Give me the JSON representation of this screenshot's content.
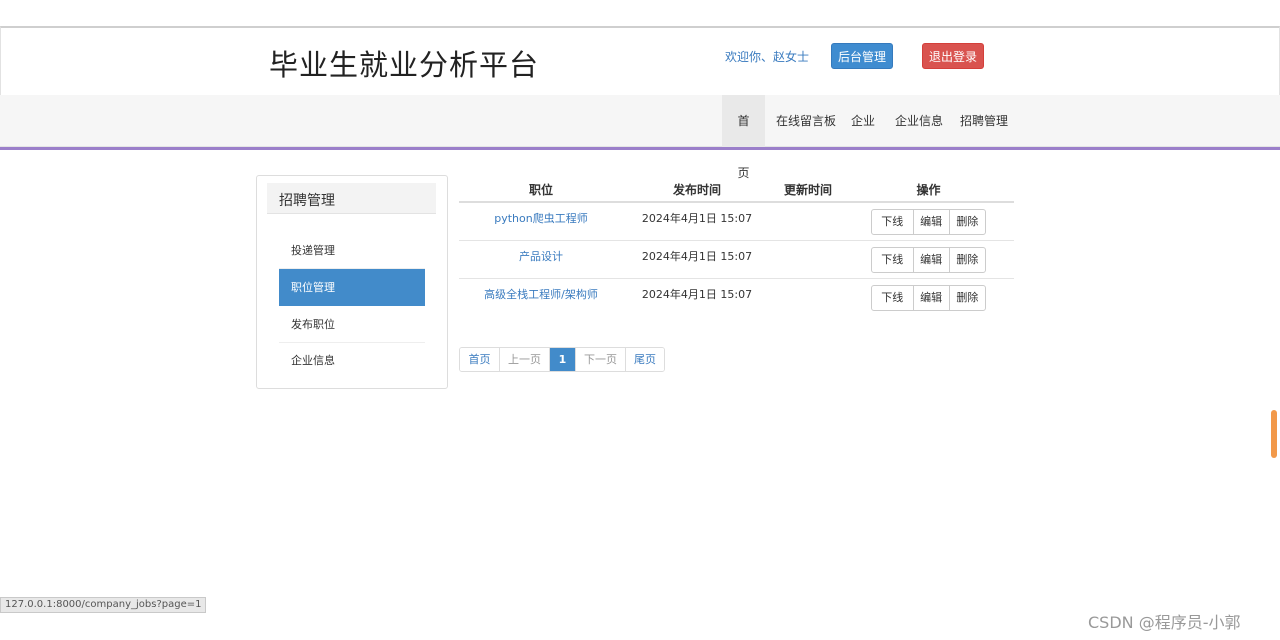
{
  "header": {
    "site_title": "毕业生就业分析平台",
    "welcome": "欢迎你、赵女士",
    "admin_button": "后台管理",
    "logout_button": "退出登录"
  },
  "nav": {
    "items": [
      {
        "label": "首页"
      },
      {
        "label": "在线留言板"
      },
      {
        "label": "企业"
      },
      {
        "label": "企业信息"
      },
      {
        "label": "招聘管理"
      }
    ]
  },
  "sidebar": {
    "title": "招聘管理",
    "items": [
      {
        "label": "投递管理"
      },
      {
        "label": "职位管理"
      },
      {
        "label": "发布职位"
      },
      {
        "label": "企业信息"
      }
    ]
  },
  "table": {
    "headers": [
      "职位",
      "发布时间",
      "更新时间",
      "操作"
    ],
    "rows": [
      {
        "position": "python爬虫工程师",
        "published": "2024年4月1日 15:07",
        "updated": ""
      },
      {
        "position": "产品设计",
        "published": "2024年4月1日 15:07",
        "updated": ""
      },
      {
        "position": "高级全栈工程师/架构师",
        "published": "2024年4月1日 15:07",
        "updated": ""
      }
    ],
    "actions": {
      "offline": "下线",
      "edit": "编辑",
      "delete": "删除"
    }
  },
  "pagination": {
    "first": "首页",
    "prev": "上一页",
    "current": "1",
    "next": "下一页",
    "last": "尾页"
  },
  "status_url": "127.0.0.1:8000/company_jobs?page=1",
  "watermark": "CSDN @程序员-小郭",
  "colors": {
    "primary": "#428bca",
    "danger": "#d9534f",
    "nav_accent": "#9b7fca",
    "link": "#3a7bbf"
  }
}
